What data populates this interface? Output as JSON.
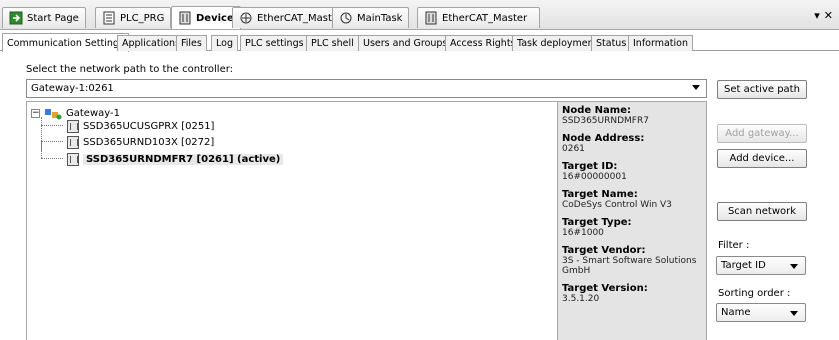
{
  "doc_tabs": [
    {
      "label": "Start Page",
      "icon": "start-page-icon"
    },
    {
      "label": "PLC_PRG",
      "icon": "document-icon"
    },
    {
      "label": "Device",
      "icon": "device-icon"
    },
    {
      "label": "EtherCAT_Master",
      "icon": "ethercat-icon"
    },
    {
      "label": "MainTask",
      "icon": "task-icon"
    },
    {
      "label": "EtherCAT_Master",
      "icon": "device-icon"
    }
  ],
  "settings_tabs": [
    "Communication Settings",
    "Applications",
    "Files",
    "Log",
    "PLC settings",
    "PLC shell",
    "Users and Groups",
    "Access Rights",
    "Task deployment",
    "Status",
    "Information"
  ],
  "path": {
    "label": "Select the network path to the controller:",
    "value": "Gateway-1:0261"
  },
  "tree": {
    "gateway": "Gateway-1",
    "devices": [
      "SSD365UCUSGPRX [0251]",
      "SSD365URND103X [0272]",
      "SSD365URNDMFR7 [0261] (active)"
    ]
  },
  "info": [
    {
      "key": "Node Name:",
      "value": "SSD365URNDMFR7"
    },
    {
      "key": "Node Address:",
      "value": "0261"
    },
    {
      "key": "Target ID:",
      "value": "16#00000001"
    },
    {
      "key": "Target Name:",
      "value": "CoDeSys Control Win V3"
    },
    {
      "key": "Target Type:",
      "value": "16#1000"
    },
    {
      "key": "Target Vendor:",
      "value": "3S - Smart Software Solutions GmbH"
    },
    {
      "key": "Target Version:",
      "value": "3.5.1.20"
    }
  ],
  "buttons": {
    "set_active_path": "Set active path",
    "add_gateway": "Add gateway...",
    "add_device": "Add device...",
    "scan_network": "Scan network"
  },
  "filter": {
    "label": "Filter :",
    "value": "Target ID"
  },
  "sorting": {
    "label": "Sorting order :",
    "value": "Name"
  }
}
